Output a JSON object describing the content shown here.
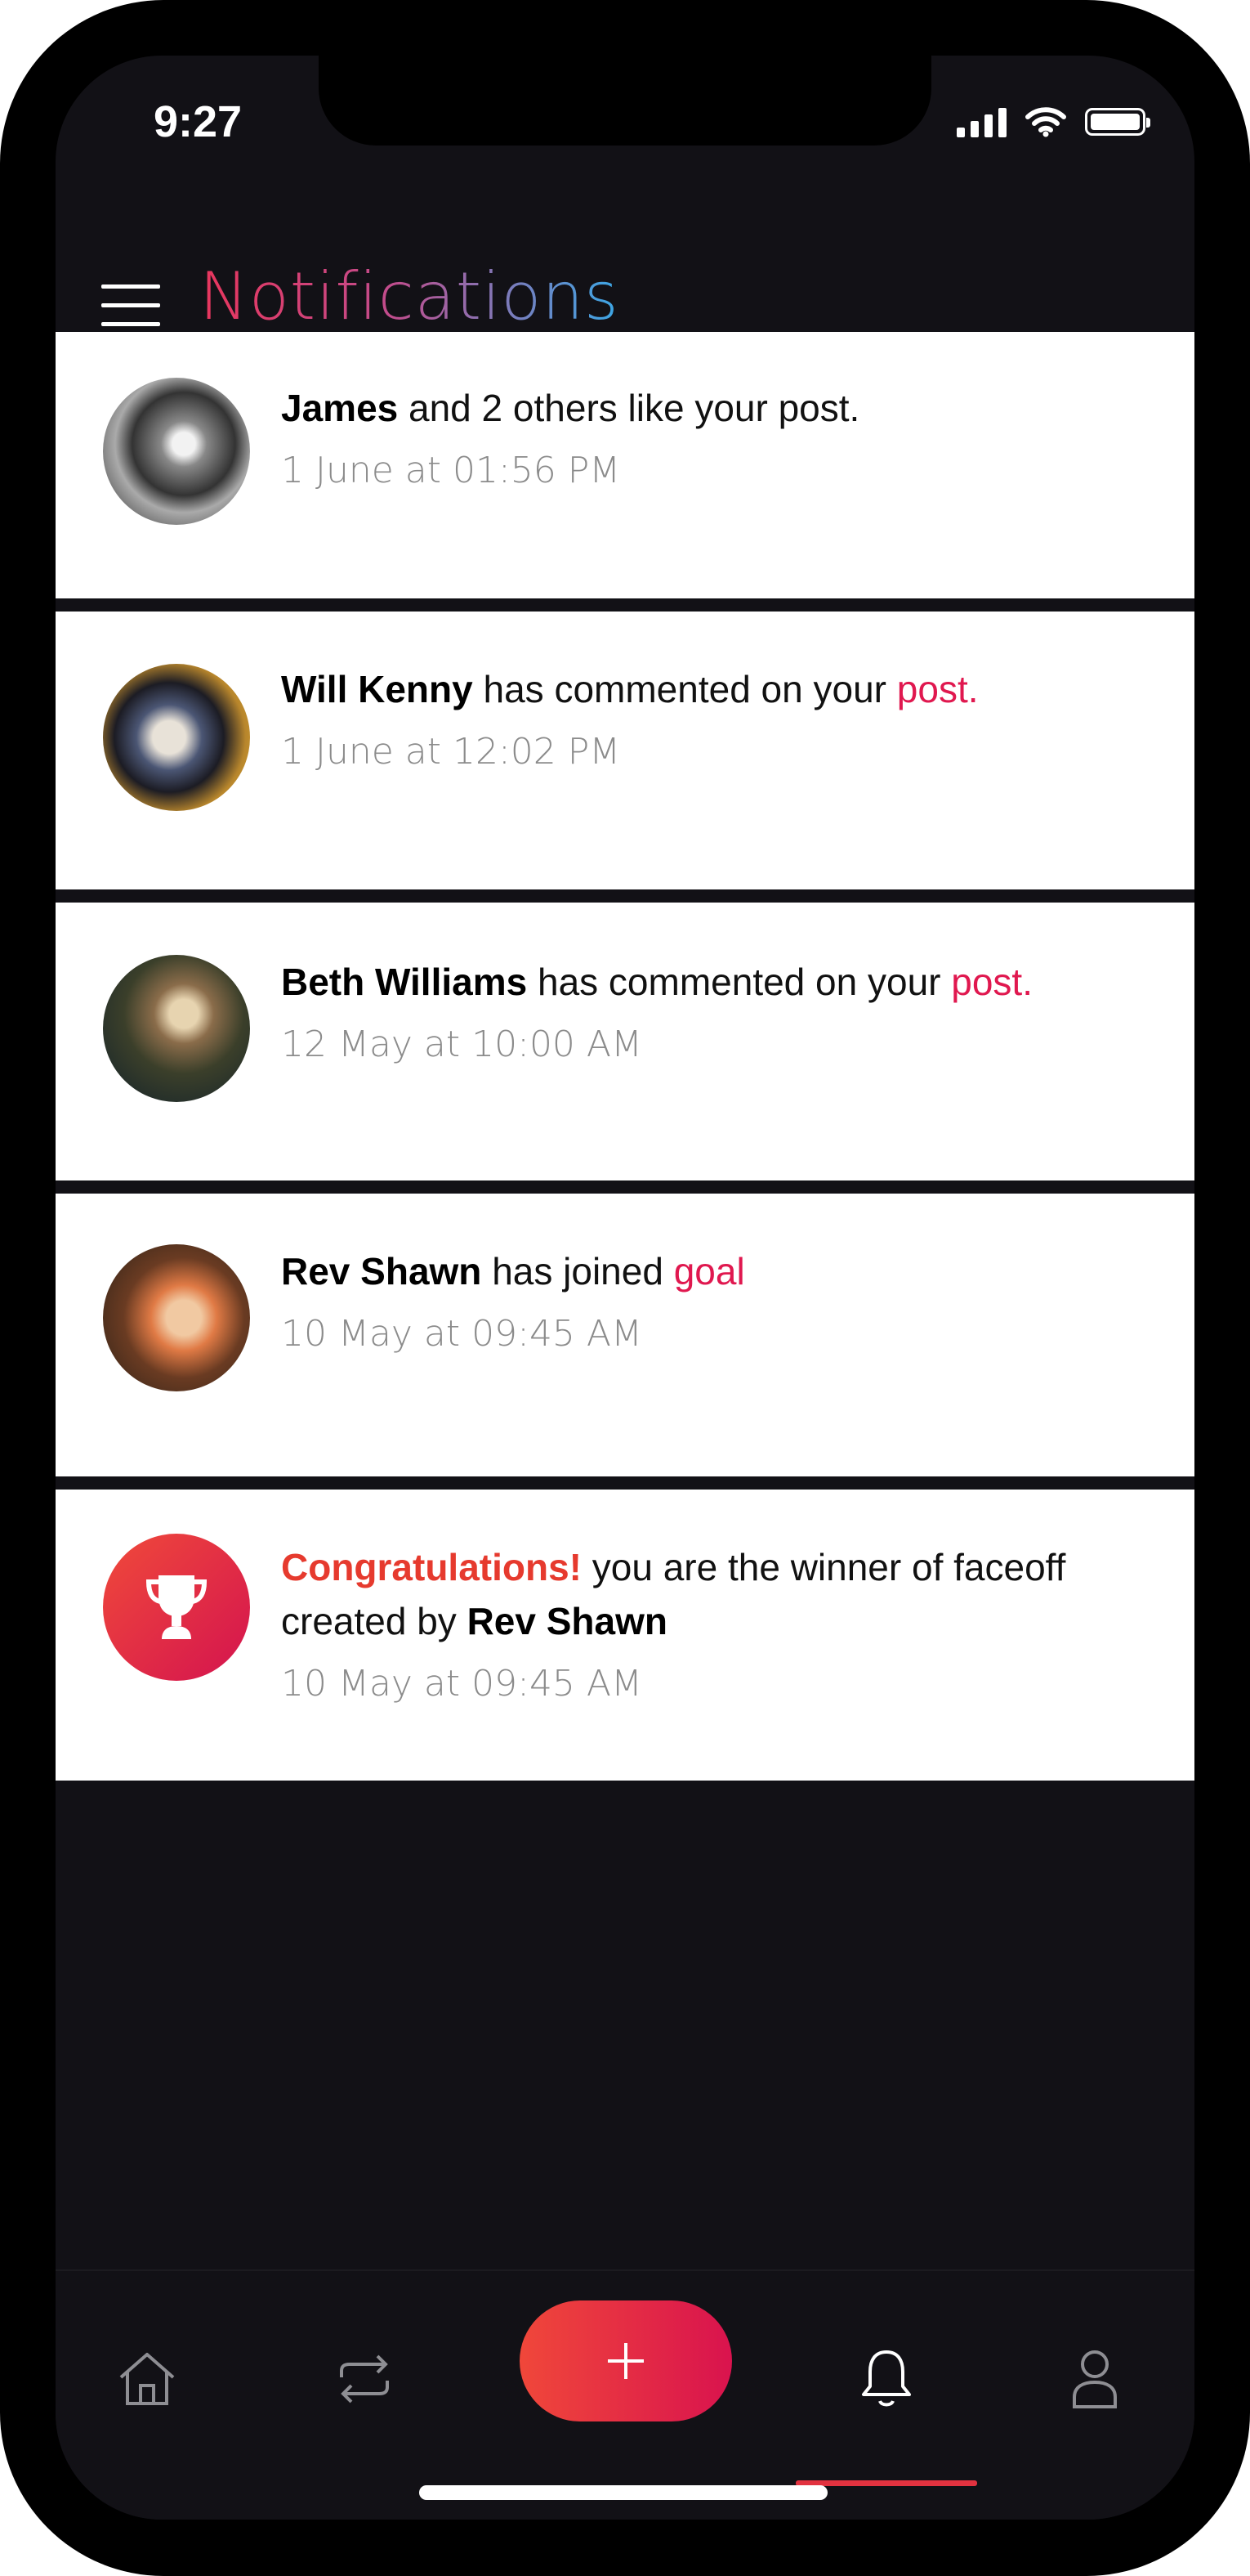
{
  "status_bar": {
    "time": "9:27"
  },
  "header": {
    "title": "Notifications",
    "title_gradient": [
      "#e8365d",
      "#c24c8c",
      "#3ba7e6"
    ]
  },
  "notifications": [
    {
      "name": "James",
      "text": "and 2 others like your post.",
      "link": "",
      "timestamp": "1 June at 01:56 PM"
    },
    {
      "name": "Will Kenny",
      "text": "has commented on your",
      "link": "post.",
      "timestamp": "1 June at 12:02 PM"
    },
    {
      "name": "Beth Williams",
      "text": "has commented on your",
      "link": "post.",
      "timestamp": "12 May at 10:00 AM"
    },
    {
      "name": "Rev Shawn",
      "text": "has joined",
      "link": "goal",
      "timestamp": "10 May at 09:45 AM"
    },
    {
      "highlight": "Congratulations!",
      "text": "you are the winner of faceoff created by",
      "name": "Rev Shawn",
      "timestamp": "10 May at 09:45 AM",
      "icon": "trophy-icon"
    }
  ],
  "bottom_nav": {
    "items": [
      "home-icon",
      "repeat-icon",
      "plus-icon",
      "bell-icon",
      "user-icon"
    ],
    "active": "bell-icon"
  },
  "colors": {
    "accent": "#e0184f",
    "background": "#121116",
    "card": "#ffffff",
    "button_gradient": [
      "#f0473a",
      "#d9134e"
    ]
  }
}
